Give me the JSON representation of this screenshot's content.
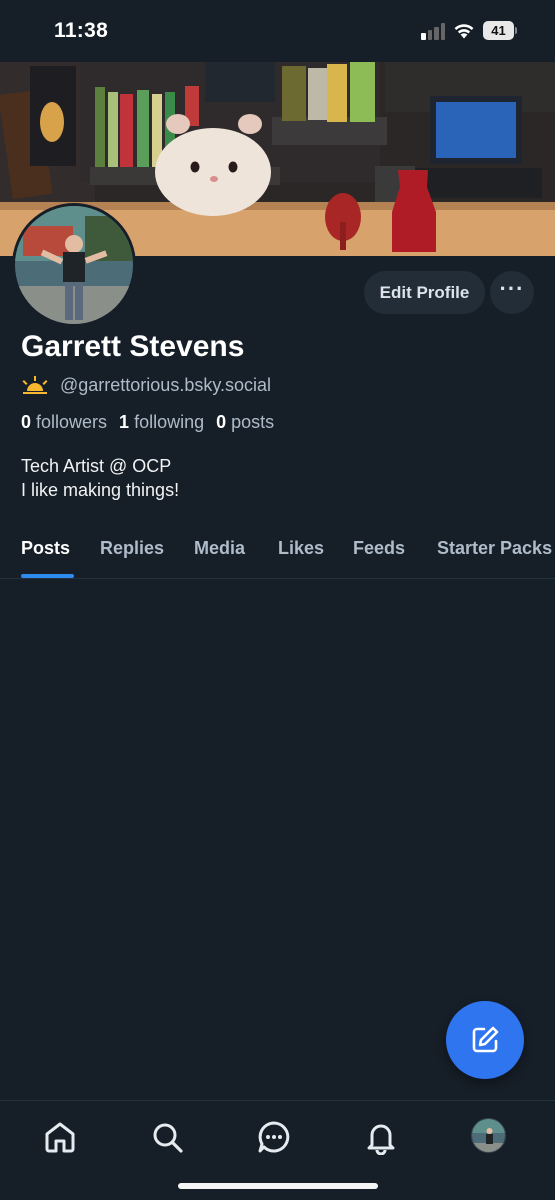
{
  "status_bar": {
    "time": "11:38",
    "battery": "41"
  },
  "profile": {
    "display_name": "Garrett Stevens",
    "handle": "@garrettorious.bsky.social",
    "handle_emoji_icon": "sunrise-icon",
    "stats": {
      "followers_count": "0",
      "followers_label": "followers",
      "following_count": "1",
      "following_label": "following",
      "posts_count": "0",
      "posts_label": "posts"
    },
    "bio_line1": "Tech Artist @ OCP",
    "bio_line2": "I like making things!"
  },
  "actions": {
    "edit_profile": "Edit Profile",
    "more_label": "···"
  },
  "tabs": [
    {
      "label": "Posts",
      "active": true
    },
    {
      "label": "Replies"
    },
    {
      "label": "Media"
    },
    {
      "label": "Likes"
    },
    {
      "label": "Feeds"
    },
    {
      "label": "Starter Packs"
    }
  ],
  "bottom_nav": [
    {
      "icon": "home-icon"
    },
    {
      "icon": "search-icon"
    },
    {
      "icon": "chat-icon"
    },
    {
      "icon": "bell-icon"
    },
    {
      "icon": "avatar"
    }
  ],
  "colors": {
    "background": "#161e27",
    "accent": "#2d8cf0",
    "fab": "#2f75f0",
    "secondary_text": "#aebbc9"
  }
}
